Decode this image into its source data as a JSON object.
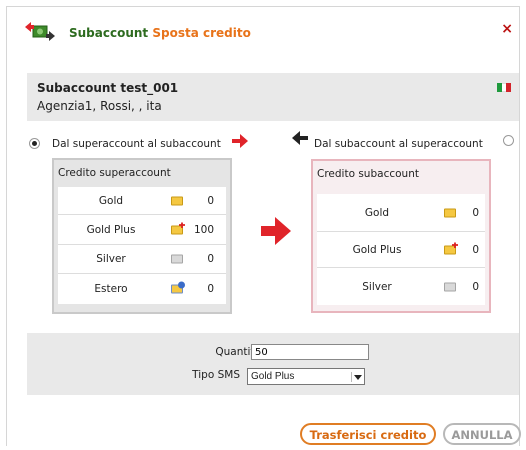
{
  "header": {
    "title_part1": "Subaccount",
    "title_part2": "Sposta credito",
    "close_label": "×"
  },
  "account": {
    "name": "Subaccount test_001",
    "details": "Agenzia1, Rossi, , ita"
  },
  "direction": {
    "option_left_label": "Dal superaccount al subaccount",
    "option_right_label": "Dal subaccount al superaccount",
    "selected": "left"
  },
  "super_panel": {
    "title": "Credito superaccount",
    "rows": [
      {
        "name": "Gold",
        "icon": "envelope-icon",
        "value": "0"
      },
      {
        "name": "Gold Plus",
        "icon": "envelope-plus-icon",
        "value": "100"
      },
      {
        "name": "Silver",
        "icon": "envelope-grey-icon",
        "value": "0"
      },
      {
        "name": "Estero",
        "icon": "envelope-world-icon",
        "value": "0"
      }
    ]
  },
  "sub_panel": {
    "title": "Credito subaccount",
    "rows": [
      {
        "name": "Gold",
        "icon": "envelope-icon",
        "value": "0"
      },
      {
        "name": "Gold Plus",
        "icon": "envelope-plus-icon",
        "value": "0"
      },
      {
        "name": "Silver",
        "icon": "envelope-grey-icon",
        "value": "0"
      }
    ]
  },
  "form": {
    "quantity_label": "Quantità",
    "quantity_value": "50",
    "sms_type_label": "Tipo SMS",
    "sms_type_selected": "Gold Plus"
  },
  "buttons": {
    "transfer_label": "Trasferisci credito",
    "cancel_label": "ANNULLA"
  },
  "colors": {
    "accent_green": "#2d6b1f",
    "accent_orange": "#e8731a",
    "arrow_red": "#e0242a",
    "close_red": "#bb1111"
  }
}
